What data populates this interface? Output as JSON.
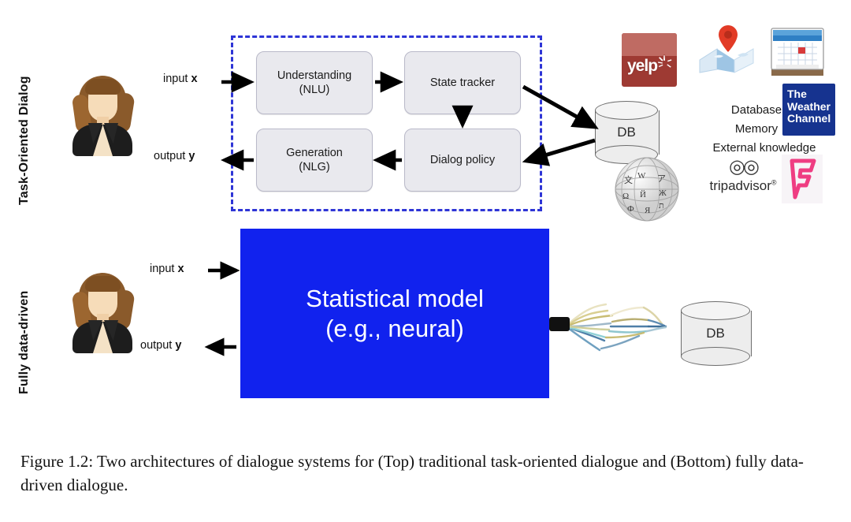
{
  "figure": {
    "caption": "Figure 1.2: Two architectures of dialogue systems for (Top) traditional task-oriented dialogue and (Bottom) fully data-driven dialogue."
  },
  "rows": {
    "top_label": "Task-Oriented Dialog",
    "bottom_label": "Fully data-driven"
  },
  "top_row": {
    "input_label_prefix": "input ",
    "input_label_var": "x",
    "output_label_prefix": "output ",
    "output_label_var": "y",
    "modules": [
      {
        "id": "nlu",
        "line1": "Understanding",
        "line2": "(NLU)"
      },
      {
        "id": "state",
        "line1": "State tracker",
        "line2": ""
      },
      {
        "id": "policy",
        "line1": "Dialog policy",
        "line2": ""
      },
      {
        "id": "nlg",
        "line1": "Generation",
        "line2": "(NLG)"
      }
    ],
    "db_label": "DB",
    "knowledge_lines": [
      "Database",
      "Memory",
      "External knowledge"
    ],
    "logos": [
      {
        "id": "yelp",
        "name": "yelp-logo",
        "text": "yelp"
      },
      {
        "id": "maps",
        "name": "map-pin-icon",
        "text": ""
      },
      {
        "id": "calendar",
        "name": "calendar-icon",
        "text": ""
      },
      {
        "id": "weather",
        "name": "the-weather-channel-logo",
        "l1": "The",
        "l2": "Weather",
        "l3": "Channel"
      },
      {
        "id": "wikipedia",
        "name": "wikipedia-globe-icon",
        "text": ""
      },
      {
        "id": "tripadvisor",
        "name": "tripadvisor-logo",
        "text": "tripadvisor",
        "mark": "®"
      },
      {
        "id": "foursquare",
        "name": "foursquare-logo",
        "text": ""
      }
    ]
  },
  "bottom_row": {
    "input_label_prefix": "input ",
    "input_label_var": "x",
    "output_label_prefix": "output ",
    "output_label_var": "y",
    "model_line1": "Statistical model",
    "model_line2": "(e.g., neural)",
    "db_label": "DB"
  },
  "colors": {
    "dashed_border": "#2e35d6",
    "model_fill": "#1122ee",
    "module_fill": "#e9e9ee",
    "yelp_red": "#9e3a33",
    "weather_blue": "#16338f",
    "foursquare_pink": "#ef3d82"
  }
}
